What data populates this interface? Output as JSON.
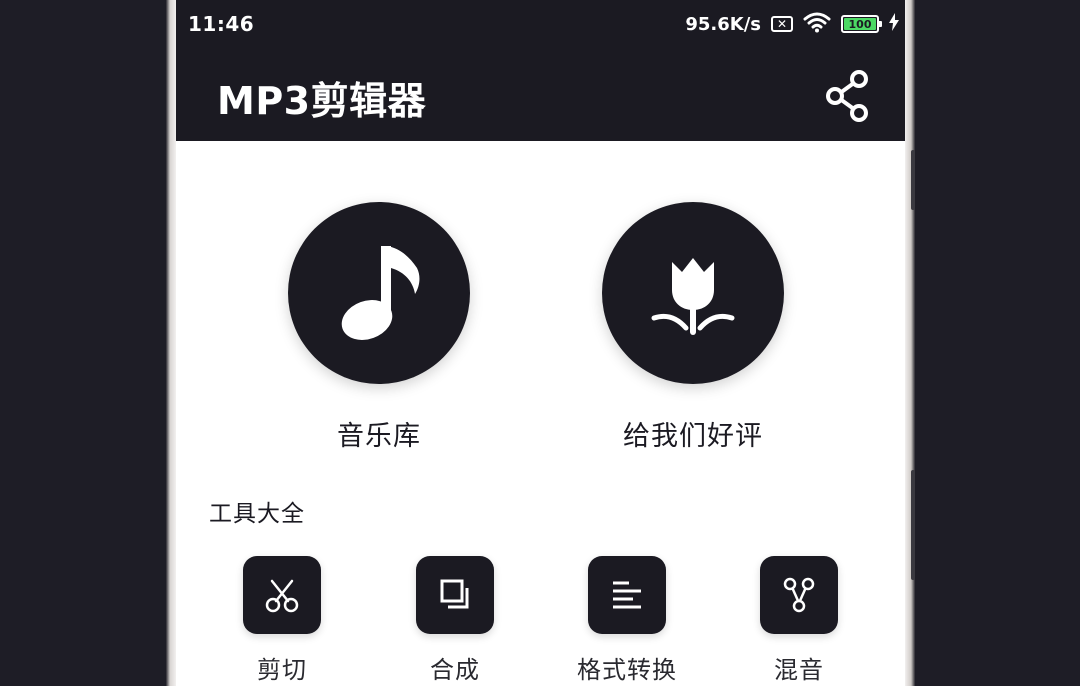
{
  "status_bar": {
    "time": "11:46",
    "network_speed": "95.6K/s",
    "sim_icon": "sim-x-icon",
    "wifi_icon": "wifi-icon",
    "battery_level": "100",
    "charging_icon": "charging-bolt-icon"
  },
  "app_bar": {
    "title": "MP3剪辑器",
    "share_icon": "share-icon"
  },
  "features": [
    {
      "label": "音乐库",
      "icon": "music-note-icon"
    },
    {
      "label": "给我们好评",
      "icon": "tulip-icon"
    }
  ],
  "tools_section": {
    "title": "工具大全",
    "items": [
      {
        "label": "剪切",
        "icon": "scissors-icon"
      },
      {
        "label": "合成",
        "icon": "merge-squares-icon"
      },
      {
        "label": "格式转换",
        "icon": "format-lines-icon"
      },
      {
        "label": "混音",
        "icon": "mix-nodes-icon"
      }
    ]
  },
  "colors": {
    "background": "#1e1d26",
    "header": "#1b1a22",
    "screen": "#ffffff",
    "battery_fill": "#4cd964"
  }
}
